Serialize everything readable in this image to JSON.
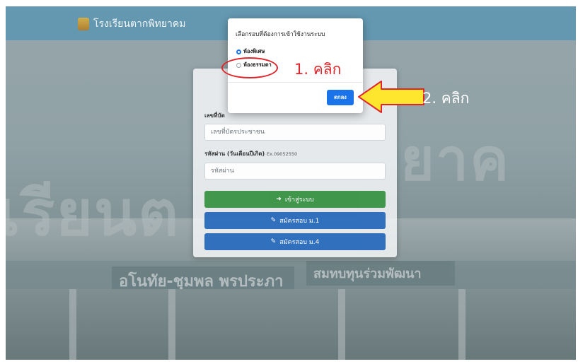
{
  "navbar": {
    "brand": "โรงเรียนตากพิทยาคม"
  },
  "background": {
    "left_letters": "เรียนต",
    "right_letters": "ยาค",
    "sign_left": "อโนทัย-ชุมพล พรประภา",
    "sign_right": "สมทบทุนร่วมพัฒนา"
  },
  "login": {
    "id_label": "เลขที่บัต",
    "id_placeholder": "เลขที่บัตรประชาชน",
    "password_label": "รหัสผ่าน (วันเดือนปีเกิด)",
    "password_hint": "Ex.09052550",
    "password_placeholder": "รหัสผ่าน",
    "login_button": "เข้าสู่ระบบ",
    "apply_m1_button": "สมัครสอบ ม.1",
    "apply_m4_button": "สมัครสอบ ม.4"
  },
  "modal": {
    "title": "เลือกรอบที่ต้องการเข้าใช้งานระบบ",
    "options": [
      {
        "label": "ห้องพิเศษ",
        "checked": true
      },
      {
        "label": "ห้องธรรมดา",
        "checked": false
      }
    ],
    "ok_button": "ตกลง"
  },
  "annotations": {
    "step1": "1.  คลิก",
    "step2": "2. คลิก"
  },
  "colors": {
    "navbar": "#3c8eb6",
    "primary": "#1a73e8",
    "success": "#2f8f3c",
    "annotation_red": "#e0262b",
    "arrow_yellow": "#ffe62e"
  }
}
